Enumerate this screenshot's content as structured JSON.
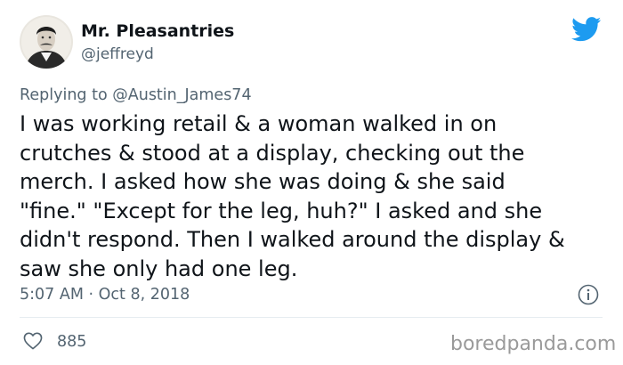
{
  "author": {
    "name": "Mr. Pleasantries",
    "handle": "@jeffreyd"
  },
  "reply": {
    "prefix": "Replying to",
    "target": "@Austin_James74"
  },
  "body": {
    "lines": [
      "I was working retail & a woman walked in on",
      "crutches & stood at a display, checking out the",
      "merch. I asked how she was doing & she said",
      "\"fine.\" \"Except for the leg, huh?\" I asked and she",
      "didn't respond. Then I walked around the display &",
      "saw she only had one leg."
    ]
  },
  "meta": {
    "timestamp": "5:07 AM · Oct 8, 2018"
  },
  "actions": {
    "like_count": "885"
  },
  "watermark": "boredpanda.com",
  "icons": {
    "brand": "twitter-bird-icon",
    "info": "info-icon",
    "like": "heart-icon"
  },
  "colors": {
    "brand_blue": "#1d9bf0",
    "text_primary": "#0f1419",
    "text_secondary": "#536471"
  }
}
